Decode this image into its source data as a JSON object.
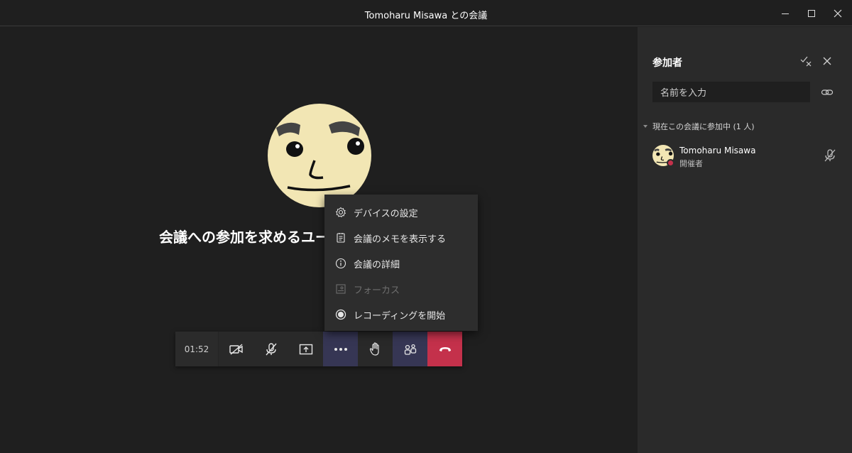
{
  "window": {
    "title": "Tomoharu Misawa との会議"
  },
  "stage": {
    "invite_text": "会議への参加を求めるユーザー"
  },
  "toolbar": {
    "timer": "01:52",
    "buttons": [
      "camera-off",
      "mic-off",
      "share",
      "more",
      "raise-hand",
      "participants",
      "hang-up"
    ]
  },
  "more_menu": {
    "items": [
      {
        "label": "デバイスの設定",
        "icon": "gear-icon",
        "enabled": true
      },
      {
        "label": "会議のメモを表示する",
        "icon": "notes-icon",
        "enabled": true
      },
      {
        "label": "会議の詳細",
        "icon": "info-icon",
        "enabled": true
      },
      {
        "label": "フォーカス",
        "icon": "focus-icon",
        "enabled": false
      },
      {
        "label": "レコーディングを開始",
        "icon": "record-icon",
        "enabled": true
      }
    ]
  },
  "panel": {
    "title": "参加者",
    "search_placeholder": "名前を入力",
    "section_label": "現在この会議に参加中 (1 人)",
    "participants": [
      {
        "name": "Tomoharu Misawa",
        "role": "開催者"
      }
    ]
  },
  "colors": {
    "background": "#1f1f1f",
    "panel": "#2a2a2a",
    "hangup": "#c4314b",
    "active_button": "#363654",
    "avatar_face": "#f2e6b4"
  }
}
